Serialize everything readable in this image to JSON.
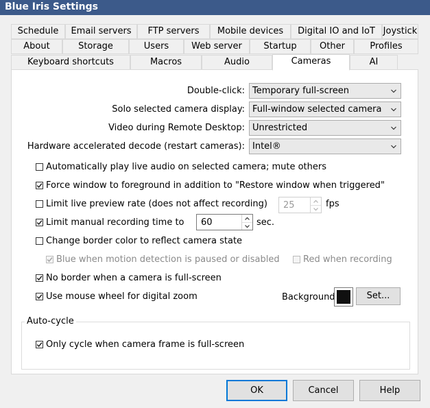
{
  "window": {
    "title": "Blue Iris Settings"
  },
  "tabs": {
    "row1": [
      "Schedule",
      "Email servers",
      "FTP servers",
      "Mobile devices",
      "Digital IO and IoT",
      "Joystick"
    ],
    "row2": [
      "About",
      "Storage",
      "Users",
      "Web server",
      "Startup",
      "Other",
      "Profiles"
    ],
    "row3": [
      "Keyboard shortcuts",
      "Macros",
      "Audio",
      "Cameras",
      "AI"
    ],
    "active": "Cameras"
  },
  "settings": {
    "double_click": {
      "label": "Double-click:",
      "value": "Temporary full-screen"
    },
    "solo_display": {
      "label": "Solo selected camera display:",
      "value": "Full-window selected camera"
    },
    "remote_desktop": {
      "label": "Video during Remote Desktop:",
      "value": "Unrestricted"
    },
    "hw_decode": {
      "label": "Hardware accelerated decode (restart cameras):",
      "value": "Intel®"
    }
  },
  "options": {
    "auto_audio": {
      "label": "Automatically play live audio on selected camera; mute others",
      "checked": false
    },
    "force_foreground": {
      "label": "Force window to foreground in addition to \"Restore window when triggered\"",
      "checked": true
    },
    "limit_preview": {
      "label": "Limit live preview rate (does not affect recording)",
      "checked": false,
      "value": "25",
      "unit": "fps"
    },
    "limit_manual": {
      "label": "Limit manual recording time to",
      "checked": true,
      "value": "60",
      "unit": "sec."
    },
    "border_color": {
      "label": "Change border color to reflect camera state",
      "checked": false
    },
    "blue_motion": {
      "label": "Blue when motion detection is paused or disabled",
      "checked": true
    },
    "red_recording": {
      "label": "Red when recording",
      "checked": false
    },
    "no_border": {
      "label": "No border when a camera is full-screen",
      "checked": true
    },
    "mouse_zoom": {
      "label": "Use mouse wheel for digital zoom",
      "checked": true
    }
  },
  "background": {
    "label": "Background",
    "color": "#101010",
    "set_label": "Set..."
  },
  "autocycle": {
    "title": "Auto-cycle",
    "only_fullscreen": {
      "label": "Only cycle when camera frame is full-screen",
      "checked": true
    }
  },
  "buttons": {
    "ok": "OK",
    "cancel": "Cancel",
    "help": "Help"
  },
  "colors": {
    "accent": "#0078d7",
    "titlebar": "#3c5a8a"
  }
}
